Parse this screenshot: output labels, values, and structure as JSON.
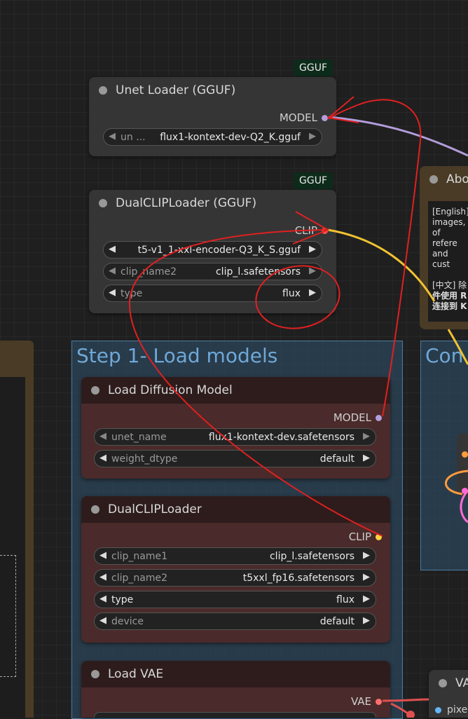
{
  "badges": {
    "gguf1": "GGUF",
    "gguf2": "GGUF"
  },
  "unet_gguf": {
    "title": "Unet Loader (GGUF)",
    "output": "MODEL",
    "widget": {
      "label": "un ...",
      "value": "flux1-kontext-dev-Q2_K.gguf"
    }
  },
  "dualclip_gguf": {
    "title": "DualCLIPLoader (GGUF)",
    "output": "CLIP",
    "widgets": [
      {
        "label": "",
        "value": "t5-v1_1-xxl-encoder-Q3_K_S.gguf"
      },
      {
        "label": "clip_name2",
        "value": "clip_l.safetensors"
      },
      {
        "label": "type",
        "value": "flux"
      }
    ]
  },
  "right_node": {
    "title": "Abo",
    "lines": [
      "[English]",
      "images,",
      "of refere",
      "and cust",
      "",
      "[中文] 除",
      "件使用 R",
      "连接到 K"
    ]
  },
  "group": {
    "title": "Step 1- Load models",
    "right_title": "Con"
  },
  "load_diffusion": {
    "title": "Load Diffusion Model",
    "output": "MODEL",
    "widgets": [
      {
        "label": "unet_name",
        "value": "flux1-kontext-dev.safetensors"
      },
      {
        "label": "weight_dtype",
        "value": "default"
      }
    ]
  },
  "dualclip": {
    "title": "DualCLIPLoader",
    "output": "CLIP",
    "widgets": [
      {
        "label": "clip_name1",
        "value": "clip_l.safetensors"
      },
      {
        "label": "clip_name2",
        "value": "t5xxl_fp16.safetensors"
      },
      {
        "label": "type",
        "value": "flux"
      },
      {
        "label": "device",
        "value": "default"
      }
    ]
  },
  "load_vae": {
    "title": "Load VAE",
    "output": "VAE"
  },
  "bottom_right": {
    "title": "VA",
    "input": "pixe"
  },
  "colors": {
    "model": "#b39ddb",
    "clip": "#ffd33d",
    "vae": "#ff6e6e",
    "annotation": "#e02020"
  }
}
